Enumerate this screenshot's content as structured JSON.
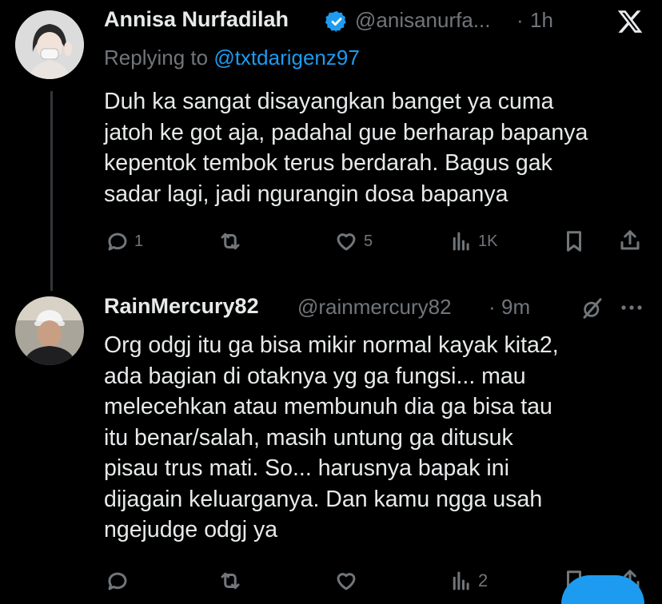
{
  "tweet1": {
    "display_name": "Annisa Nurfadilah",
    "handle": "@anisanurfa...",
    "separator": "·",
    "time": "1h",
    "replying_prefix": "Replying to",
    "replying_to": "@txtdarigenz97",
    "text": "Duh ka sangat disayangkan banget ya cuma\njatoh ke got aja, padahal gue berharap bapanya\nkepentok tembok terus berdarah. Bagus gak\nsadar lagi, jadi ngurangin dosa bapanya",
    "reply_count": "1",
    "like_count": "5",
    "view_count": "1K"
  },
  "tweet2": {
    "display_name": "RainMercury82",
    "handle": "@rainmercury82",
    "separator": "·",
    "time": "9m",
    "text": "Org odgj itu ga bisa mikir normal kayak kita2,\nada bagian di otaknya yg ga fungsi... mau\nmelecehkan atau membunuh  dia ga bisa tau\nitu benar/salah, masih untung ga ditusuk\npisau trus mati. So... harusnya bapak ini\ndijagain keluarganya. Dan kamu ngga usah\nngejudge odgj ya",
    "view_count": "2"
  },
  "icons": {
    "verified": "verified-badge-icon",
    "x_logo": "x-logo-icon",
    "reply": "reply-icon",
    "retweet": "retweet-icon",
    "like": "heart-icon",
    "views": "views-icon",
    "bookmark": "bookmark-icon",
    "share": "share-icon",
    "grok": "grok-icon",
    "more": "more-icon"
  },
  "colors": {
    "background": "#000000",
    "text": "#e7e9ea",
    "muted": "#71767b",
    "accent": "#1d9bf0"
  }
}
